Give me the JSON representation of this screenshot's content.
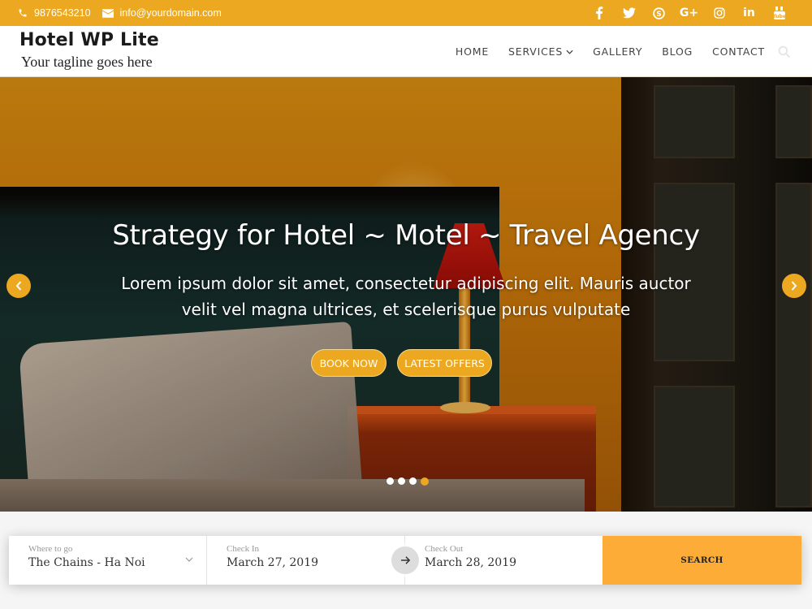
{
  "topbar": {
    "phone": "9876543210",
    "email": "info@yourdomain.com",
    "social": [
      {
        "icon": "facebook-icon",
        "glyph": "f"
      },
      {
        "icon": "twitter-icon",
        "glyph": "🐦"
      },
      {
        "icon": "skype-icon",
        "glyph": "S"
      },
      {
        "icon": "google-plus-icon",
        "glyph": "G+"
      },
      {
        "icon": "instagram-icon",
        "glyph": "◎"
      },
      {
        "icon": "linkedin-icon",
        "glyph": "in"
      },
      {
        "icon": "youtube-icon",
        "glyph": "▶"
      }
    ],
    "color": "#eca820"
  },
  "header": {
    "title": "Hotel WP Lite",
    "tagline": "Your tagline goes here",
    "nav": [
      {
        "label": "HOME"
      },
      {
        "label": "SERVICES",
        "has_dropdown": true
      },
      {
        "label": "GALLERY"
      },
      {
        "label": "BLOG"
      },
      {
        "label": "CONTACT"
      }
    ]
  },
  "hero": {
    "title": "Strategy for Hotel ~ Motel ~ Travel Agency",
    "subtitle": "Lorem ipsum dolor sit amet, consectetur adipiscing elit. Mauris auctor velit vel magna ultrices, et scelerisque purus vulputate",
    "buttons": {
      "book": "BOOK NOW",
      "offers": "LATEST OFFERS"
    },
    "slides_total": 4,
    "active_slide": 4
  },
  "booking": {
    "where": {
      "label": "Where to go",
      "value": "The Chains - Ha Noi"
    },
    "check_in": {
      "label": "Check In",
      "value": "March 27, 2019"
    },
    "check_out": {
      "label": "Check Out",
      "value": "March 28, 2019"
    },
    "search_label": "SEARCH",
    "accent": "#fdac38"
  }
}
